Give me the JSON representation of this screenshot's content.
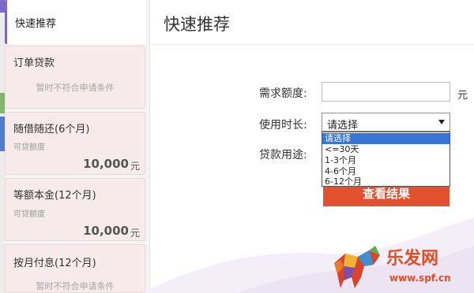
{
  "sidebar": {
    "active": {
      "title": "快速推荐"
    },
    "items": [
      {
        "title": "订单贷款",
        "note": "暂时不符合申请条件"
      },
      {
        "title": "随借随还(6个月)",
        "sub": "可贷额度",
        "amount": "10,000",
        "unit": "元"
      },
      {
        "title": "等额本金(12个月)",
        "sub": "可贷额度",
        "amount": "10,000",
        "unit": "元"
      },
      {
        "title": "按月付息(12个月)",
        "note": "暂时不符合申请条件"
      }
    ]
  },
  "main": {
    "title": "快速推荐",
    "form": {
      "amount_label": "需求额度:",
      "amount_value": "",
      "amount_unit": "元",
      "term_label": "使用时长:",
      "term_selected": "请选择",
      "term_options": [
        "请选择",
        "<=30天",
        "1-3个月",
        "4-6个月",
        "6-12个月"
      ],
      "purpose_label": "贷款用途:",
      "submit_label": "查看结果"
    }
  },
  "watermark": {
    "brand": "乐发网",
    "site": "www.spf.cn"
  },
  "colors": {
    "accent": "#e3502e",
    "active_bar": "#7b68c8",
    "card_bg": "#f7eaea",
    "select_highlight": "#3875d7"
  }
}
